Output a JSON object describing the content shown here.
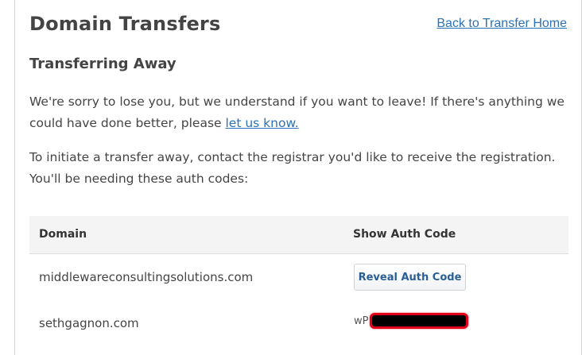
{
  "header": {
    "title": "Domain Transfers",
    "back_link": "Back to Transfer Home"
  },
  "section": {
    "title": "Transferring Away",
    "para1_text": "We're sorry to lose you, but we understand if you want to leave! If there's anything we could have done better, please ",
    "para1_link": "let us know.",
    "para2_text": "To initiate a transfer away, contact the registrar you'd like to receive the registration. You'll be needing these auth codes:"
  },
  "table": {
    "headers": {
      "domain": "Domain",
      "auth": "Show Auth Code"
    },
    "rows": [
      {
        "domain": "middlewareconsultingsolutions.com",
        "action_label": "Reveal Auth Code"
      },
      {
        "domain": "sethgagnon.com",
        "auth_code_prefix": "wP"
      }
    ]
  },
  "colors": {
    "link": "#2a72b5",
    "redaction_border": "#e3001b"
  }
}
